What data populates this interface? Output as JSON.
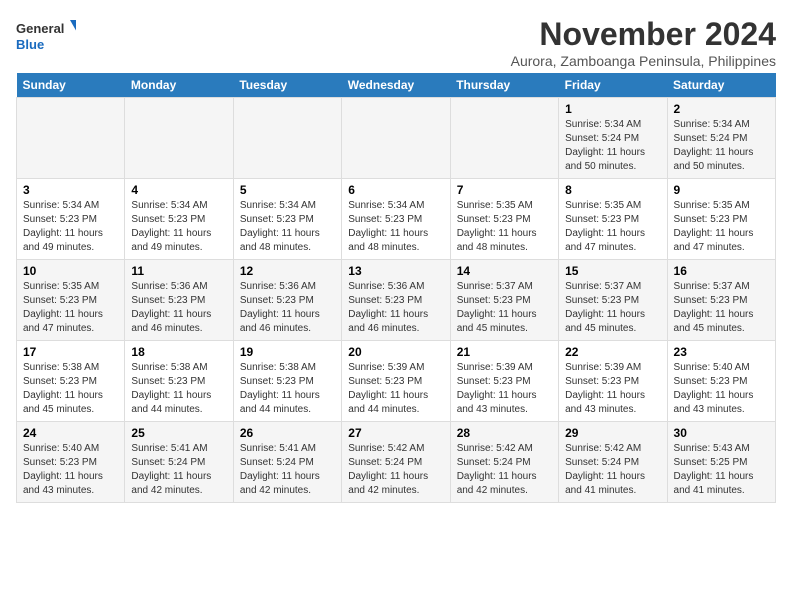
{
  "header": {
    "logo_line1": "General",
    "logo_line2": "Blue",
    "title": "November 2024",
    "subtitle": "Aurora, Zamboanga Peninsula, Philippines"
  },
  "weekdays": [
    "Sunday",
    "Monday",
    "Tuesday",
    "Wednesday",
    "Thursday",
    "Friday",
    "Saturday"
  ],
  "weeks": [
    [
      {
        "day": "",
        "info": ""
      },
      {
        "day": "",
        "info": ""
      },
      {
        "day": "",
        "info": ""
      },
      {
        "day": "",
        "info": ""
      },
      {
        "day": "",
        "info": ""
      },
      {
        "day": "1",
        "info": "Sunrise: 5:34 AM\nSunset: 5:24 PM\nDaylight: 11 hours\nand 50 minutes."
      },
      {
        "day": "2",
        "info": "Sunrise: 5:34 AM\nSunset: 5:24 PM\nDaylight: 11 hours\nand 50 minutes."
      }
    ],
    [
      {
        "day": "3",
        "info": "Sunrise: 5:34 AM\nSunset: 5:23 PM\nDaylight: 11 hours\nand 49 minutes."
      },
      {
        "day": "4",
        "info": "Sunrise: 5:34 AM\nSunset: 5:23 PM\nDaylight: 11 hours\nand 49 minutes."
      },
      {
        "day": "5",
        "info": "Sunrise: 5:34 AM\nSunset: 5:23 PM\nDaylight: 11 hours\nand 48 minutes."
      },
      {
        "day": "6",
        "info": "Sunrise: 5:34 AM\nSunset: 5:23 PM\nDaylight: 11 hours\nand 48 minutes."
      },
      {
        "day": "7",
        "info": "Sunrise: 5:35 AM\nSunset: 5:23 PM\nDaylight: 11 hours\nand 48 minutes."
      },
      {
        "day": "8",
        "info": "Sunrise: 5:35 AM\nSunset: 5:23 PM\nDaylight: 11 hours\nand 47 minutes."
      },
      {
        "day": "9",
        "info": "Sunrise: 5:35 AM\nSunset: 5:23 PM\nDaylight: 11 hours\nand 47 minutes."
      }
    ],
    [
      {
        "day": "10",
        "info": "Sunrise: 5:35 AM\nSunset: 5:23 PM\nDaylight: 11 hours\nand 47 minutes."
      },
      {
        "day": "11",
        "info": "Sunrise: 5:36 AM\nSunset: 5:23 PM\nDaylight: 11 hours\nand 46 minutes."
      },
      {
        "day": "12",
        "info": "Sunrise: 5:36 AM\nSunset: 5:23 PM\nDaylight: 11 hours\nand 46 minutes."
      },
      {
        "day": "13",
        "info": "Sunrise: 5:36 AM\nSunset: 5:23 PM\nDaylight: 11 hours\nand 46 minutes."
      },
      {
        "day": "14",
        "info": "Sunrise: 5:37 AM\nSunset: 5:23 PM\nDaylight: 11 hours\nand 45 minutes."
      },
      {
        "day": "15",
        "info": "Sunrise: 5:37 AM\nSunset: 5:23 PM\nDaylight: 11 hours\nand 45 minutes."
      },
      {
        "day": "16",
        "info": "Sunrise: 5:37 AM\nSunset: 5:23 PM\nDaylight: 11 hours\nand 45 minutes."
      }
    ],
    [
      {
        "day": "17",
        "info": "Sunrise: 5:38 AM\nSunset: 5:23 PM\nDaylight: 11 hours\nand 45 minutes."
      },
      {
        "day": "18",
        "info": "Sunrise: 5:38 AM\nSunset: 5:23 PM\nDaylight: 11 hours\nand 44 minutes."
      },
      {
        "day": "19",
        "info": "Sunrise: 5:38 AM\nSunset: 5:23 PM\nDaylight: 11 hours\nand 44 minutes."
      },
      {
        "day": "20",
        "info": "Sunrise: 5:39 AM\nSunset: 5:23 PM\nDaylight: 11 hours\nand 44 minutes."
      },
      {
        "day": "21",
        "info": "Sunrise: 5:39 AM\nSunset: 5:23 PM\nDaylight: 11 hours\nand 43 minutes."
      },
      {
        "day": "22",
        "info": "Sunrise: 5:39 AM\nSunset: 5:23 PM\nDaylight: 11 hours\nand 43 minutes."
      },
      {
        "day": "23",
        "info": "Sunrise: 5:40 AM\nSunset: 5:23 PM\nDaylight: 11 hours\nand 43 minutes."
      }
    ],
    [
      {
        "day": "24",
        "info": "Sunrise: 5:40 AM\nSunset: 5:23 PM\nDaylight: 11 hours\nand 43 minutes."
      },
      {
        "day": "25",
        "info": "Sunrise: 5:41 AM\nSunset: 5:24 PM\nDaylight: 11 hours\nand 42 minutes."
      },
      {
        "day": "26",
        "info": "Sunrise: 5:41 AM\nSunset: 5:24 PM\nDaylight: 11 hours\nand 42 minutes."
      },
      {
        "day": "27",
        "info": "Sunrise: 5:42 AM\nSunset: 5:24 PM\nDaylight: 11 hours\nand 42 minutes."
      },
      {
        "day": "28",
        "info": "Sunrise: 5:42 AM\nSunset: 5:24 PM\nDaylight: 11 hours\nand 42 minutes."
      },
      {
        "day": "29",
        "info": "Sunrise: 5:42 AM\nSunset: 5:24 PM\nDaylight: 11 hours\nand 41 minutes."
      },
      {
        "day": "30",
        "info": "Sunrise: 5:43 AM\nSunset: 5:25 PM\nDaylight: 11 hours\nand 41 minutes."
      }
    ]
  ]
}
